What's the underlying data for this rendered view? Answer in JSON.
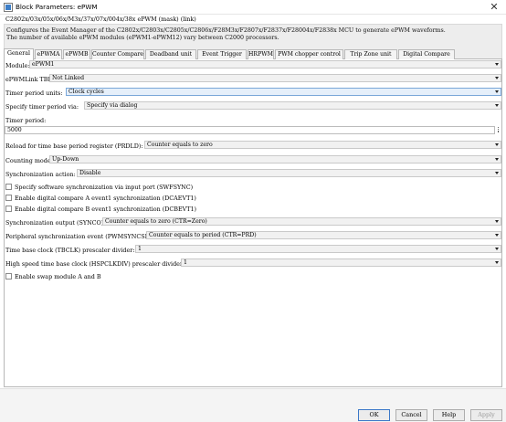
{
  "window": {
    "title": "Block Parameters: ePWM",
    "icon": "simulink-block-icon",
    "close_glyph": "✕"
  },
  "block": {
    "name": "C2802x/03x/05x/06x/M3x/37x/07x/004x/38x ePWM (mask) (link)",
    "description": [
      "Configures the Event Manager of the C2802x/C2803x/C2805x/C2806x/F28M3x/F2807x/F2837x/F28004x/F2838x MCU to generate ePWM waveforms.",
      "The number of available ePWM modules (ePWM1-ePWM12) vary between C2000 processors."
    ]
  },
  "tabs": [
    {
      "label": "General",
      "active": true
    },
    {
      "label": "ePWMA",
      "active": false
    },
    {
      "label": "ePWMB",
      "active": false
    },
    {
      "label": "Counter Compare",
      "active": false
    },
    {
      "label": "Deadband unit",
      "active": false
    },
    {
      "label": "Event Trigger",
      "active": false
    },
    {
      "label": "HRPWM",
      "active": false
    },
    {
      "label": "PWM chopper control",
      "active": false
    },
    {
      "label": "Trip Zone unit",
      "active": false
    },
    {
      "label": "Digital Compare",
      "active": false
    }
  ],
  "params": {
    "module": {
      "label": "Module:",
      "value": "ePWM1"
    },
    "link_tbprd": {
      "label": "ePWMLink TBPRD",
      "value": "Not Linked"
    },
    "timer_period_units": {
      "label": "Timer period units:",
      "value": "Clock cycles"
    },
    "specify_timer_period_via": {
      "label": "Specify timer period via:",
      "value": "Specify via dialog"
    },
    "timer_period": {
      "label": "Timer period:",
      "value": "5000"
    },
    "reload_prdld": {
      "label": "Reload for time base period register (PRDLD):",
      "value": "Counter equals to zero"
    },
    "counting_mode": {
      "label": "Counting mode:",
      "value": "Up-Down"
    },
    "sync_action": {
      "label": "Synchronization action:",
      "value": "Disable"
    },
    "swfsync": {
      "label": "Specify software synchronization via input port (SWFSYNC)",
      "checked": false
    },
    "dcaevt1": {
      "label": "Enable digital compare A event1 synchronization (DCAEVT1)",
      "checked": false
    },
    "dcbevt1": {
      "label": "Enable digital compare B event1 synchronization (DCBEVT1)",
      "checked": false
    },
    "sync_output": {
      "label": "Synchronization output (SYNCO):",
      "value": "Counter equals to zero (CTR=Zero)"
    },
    "pwmsyncsel": {
      "label": "Peripheral synchronization event (PWMSYNCSEL):",
      "value": "Counter equals to period (CTR=PRD)"
    },
    "tbclk_divider": {
      "label": "Time base clock (TBCLK) prescaler divider:",
      "value": "1"
    },
    "hspclkdiv": {
      "label": "High speed time base clock (HSPCLKDIV) prescaler divider:",
      "value": "1"
    },
    "swap_ab": {
      "label": "Enable swap module A and B",
      "checked": false
    }
  },
  "buttons": {
    "ok": "OK",
    "cancel": "Cancel",
    "help": "Help",
    "apply": "Apply"
  }
}
